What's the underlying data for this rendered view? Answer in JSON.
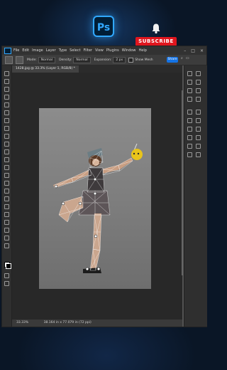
{
  "overlay": {
    "ps_logo": "Ps",
    "subscribe": "SUBSCRIBE"
  },
  "menubar": {
    "items": [
      "File",
      "Edit",
      "Image",
      "Layer",
      "Type",
      "Select",
      "Filter",
      "View",
      "Plugins",
      "Window",
      "Help"
    ]
  },
  "options": {
    "mode_label": "Mode:",
    "mode_value": "Normal",
    "density_label": "Density:",
    "density_value": "Normal",
    "expansion_label": "Expansion:",
    "expansion_value": "2 px",
    "show_mesh": "Show Mesh",
    "share": "Share"
  },
  "document": {
    "tab_title": "1428.jpg @ 33.3% (Layer 1, RGB/8) *"
  },
  "status": {
    "zoom": "33.33%",
    "info": "38.164 in x 77.079 in (72 ppi)"
  },
  "colors": {
    "ps_blue": "#31a8ff",
    "subscribe_red": "#e0161e",
    "share_blue": "#1473e6",
    "canvas_bg": "#282828"
  }
}
